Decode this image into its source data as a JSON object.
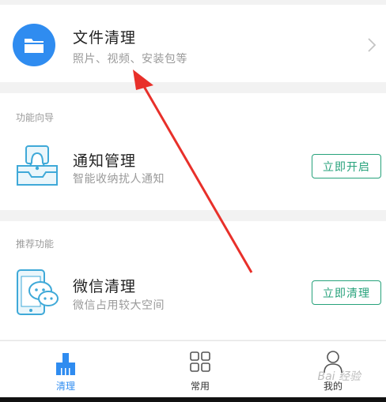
{
  "file_clean": {
    "title": "文件清理",
    "subtitle": "照片、视频、安装包等"
  },
  "guide": {
    "section_label": "功能向导",
    "title": "通知管理",
    "subtitle": "智能收纳扰人通知",
    "button": "立即开启"
  },
  "recommend": {
    "section_label": "推荐功能",
    "title": "微信清理",
    "subtitle": "微信占用较大空间",
    "button": "立即清理"
  },
  "nav": {
    "items": [
      {
        "label": "清理",
        "icon": "broom-icon",
        "active": true
      },
      {
        "label": "常用",
        "icon": "grid-icon",
        "active": false
      },
      {
        "label": "我的",
        "icon": "user-icon",
        "active": false
      }
    ]
  },
  "watermark": "Bai 经验",
  "colors": {
    "accent": "#2f8cf0",
    "button": "#27a27b",
    "arrow": "#e8302a"
  }
}
